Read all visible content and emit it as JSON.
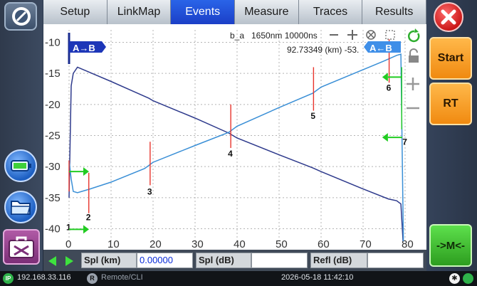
{
  "tabs": [
    "Setup",
    "LinkMap",
    "Events",
    "Measure",
    "Traces",
    "Results"
  ],
  "active_tab": "Events",
  "chart_header": {
    "trace_name": "b_a",
    "wavelength_range": "1650nm 10000ns",
    "distance_readout": "92.73349 (km) -53."
  },
  "markers": {
    "a_to_b": "A→B",
    "a_from_b": "A←B"
  },
  "right_buttons": {
    "start": "Start",
    "rt": "RT",
    "marker": "->M<-"
  },
  "measure_bar": {
    "splice_km_label": "Spl (km)",
    "splice_km_value": "0.00000",
    "splice_db_label": "Spl (dB)",
    "splice_db_value": "",
    "refl_label": "Refl (dB)",
    "refl_value": ""
  },
  "status_bar": {
    "ip_badge": "IP",
    "ip": "192.168.33.116",
    "remote_badge": "R",
    "remote": "Remote/CLI",
    "datetime": "2026-05-18  11:42:10"
  },
  "colors": {
    "active_tab": "#1f4fd8",
    "trace_a_to_b": "#2e3a8c",
    "trace_b_to_a": "#3a8fd6",
    "event_marker": "#e8342c",
    "green_marker": "#22cc22",
    "start_button": "#f5a623",
    "close_button": "#e02020"
  },
  "chart_data": {
    "type": "line",
    "x_ticks": [
      "0",
      "10",
      "20",
      "30",
      "40",
      "50",
      "60",
      "70",
      "80"
    ],
    "y_ticks": [
      "-10",
      "-15",
      "-20",
      "-25",
      "-30",
      "-35",
      "-40"
    ],
    "xlim": [
      0,
      80
    ],
    "ylim": [
      -42,
      -8
    ],
    "series": [
      {
        "x": [
          0,
          0.5,
          1,
          2,
          10,
          19,
          20,
          30,
          38,
          40,
          50,
          58,
          60,
          70,
          76,
          78,
          79,
          79.5
        ],
        "y": [
          -35,
          -17,
          -15,
          -14,
          -16.3,
          -19,
          -19.4,
          -22.2,
          -24.6,
          -25.4,
          -28.1,
          -30.2,
          -30.8,
          -33.6,
          -35.2,
          -35.5,
          -36,
          -42
        ]
      },
      {
        "x": [
          0,
          0.5,
          1,
          2,
          5,
          10,
          18,
          20,
          30,
          38,
          40,
          50,
          58,
          60,
          70,
          75,
          78,
          79,
          79.6
        ],
        "y": [
          -29,
          -32,
          -34,
          -34.2,
          -33.6,
          -32.5,
          -30.3,
          -29.3,
          -26.6,
          -24.5,
          -23.5,
          -20.5,
          -18.2,
          -17.2,
          -14.4,
          -13,
          -12.1,
          -11.9,
          -42
        ]
      }
    ],
    "events": [
      {
        "label": "1",
        "x": 0
      },
      {
        "label": "2",
        "x": 4.7
      },
      {
        "label": "3",
        "x": 19.3
      },
      {
        "label": "4",
        "x": 38.5
      },
      {
        "label": "5",
        "x": 58.2
      },
      {
        "label": "6",
        "x": 76.2
      },
      {
        "label": "7",
        "x": 79.2
      }
    ]
  }
}
